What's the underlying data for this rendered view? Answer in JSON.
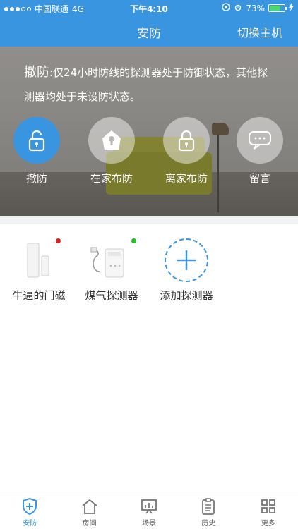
{
  "status": {
    "carrier": "中国联通",
    "network": "4G",
    "time": "下午4:10",
    "battery": "73%",
    "battery_level": 0.73
  },
  "nav": {
    "title": "安防",
    "switch_host": "切换主机"
  },
  "hero": {
    "notice_head": "撤防",
    "notice_body": ":仅24小时防线的探测器处于防御状态，其他探测器均处于未设防状态。",
    "modes": [
      {
        "label": "撤防",
        "icon": "unlock-icon",
        "active": true
      },
      {
        "label": "在家布防",
        "icon": "home-shield-icon",
        "active": false
      },
      {
        "label": "离家布防",
        "icon": "lock-icon",
        "active": false
      },
      {
        "label": "留言",
        "icon": "message-icon",
        "active": false
      }
    ]
  },
  "devices": [
    {
      "label": "牛逼的门磁",
      "icon": "door-sensor-icon",
      "led": "#e02020"
    },
    {
      "label": "煤气探测器",
      "icon": "gas-detector-icon",
      "led": "#22c022"
    },
    {
      "label": "添加探测器",
      "icon": "plus-icon"
    }
  ],
  "tabs": [
    {
      "label": "安防",
      "icon": "shield-icon",
      "active": true
    },
    {
      "label": "房间",
      "icon": "house-icon",
      "active": false
    },
    {
      "label": "场景",
      "icon": "scene-icon",
      "active": false
    },
    {
      "label": "历史",
      "icon": "clipboard-icon",
      "active": false
    },
    {
      "label": "更多",
      "icon": "grid-icon",
      "active": false
    }
  ],
  "colors": {
    "primary": "#3a95e0",
    "led_red": "#e02020",
    "led_green": "#22c022"
  }
}
